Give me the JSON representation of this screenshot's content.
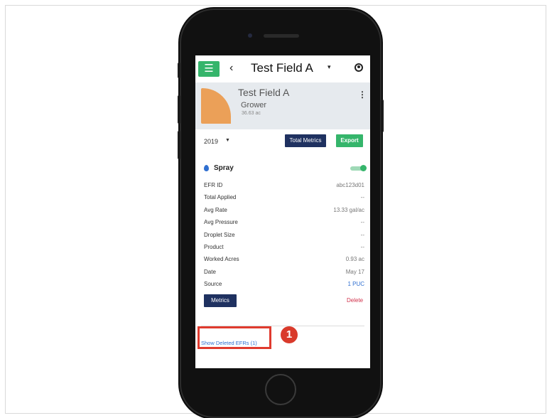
{
  "nav": {
    "menu_icon": "hamburger-icon",
    "back_icon": "chevron-left-icon",
    "back_glyph": "‹",
    "title": "Test Field A",
    "caret_glyph": "▾"
  },
  "field": {
    "name": "Test Field A",
    "grower": "Grower",
    "acres": "36.63 ac",
    "more_glyph": "⋮"
  },
  "toolbar": {
    "year": "2019",
    "year_caret": "▼",
    "total_metrics_label": "Total Metrics",
    "export_label": "Export"
  },
  "efr": {
    "operation": "Spray",
    "toggle_on": true,
    "rows": [
      {
        "label": "EFR ID",
        "value": "abc123d01"
      },
      {
        "label": "Total Applied",
        "value": "--"
      },
      {
        "label": "Avg Rate",
        "value": "13.33 gal/ac"
      },
      {
        "label": "Avg Pressure",
        "value": "--"
      },
      {
        "label": "Droplet Size",
        "value": "--"
      },
      {
        "label": "Product",
        "value": "--"
      },
      {
        "label": "Worked Acres",
        "value": "0.93 ac"
      },
      {
        "label": "Date",
        "value": "May 17"
      },
      {
        "label": "Source",
        "value": "1 PUC"
      }
    ],
    "metrics_label": "Metrics",
    "delete_label": "Delete"
  },
  "show_deleted_label": "Show Deleted EFRs (1)",
  "annotation": {
    "step_number": "1"
  },
  "colors": {
    "accent_green": "#35b56b",
    "navy": "#1f3160",
    "link_blue": "#2f6fd0",
    "delete_red": "#d0304a",
    "annotation_red": "#e03a2e",
    "field_orange": "#eba058"
  }
}
